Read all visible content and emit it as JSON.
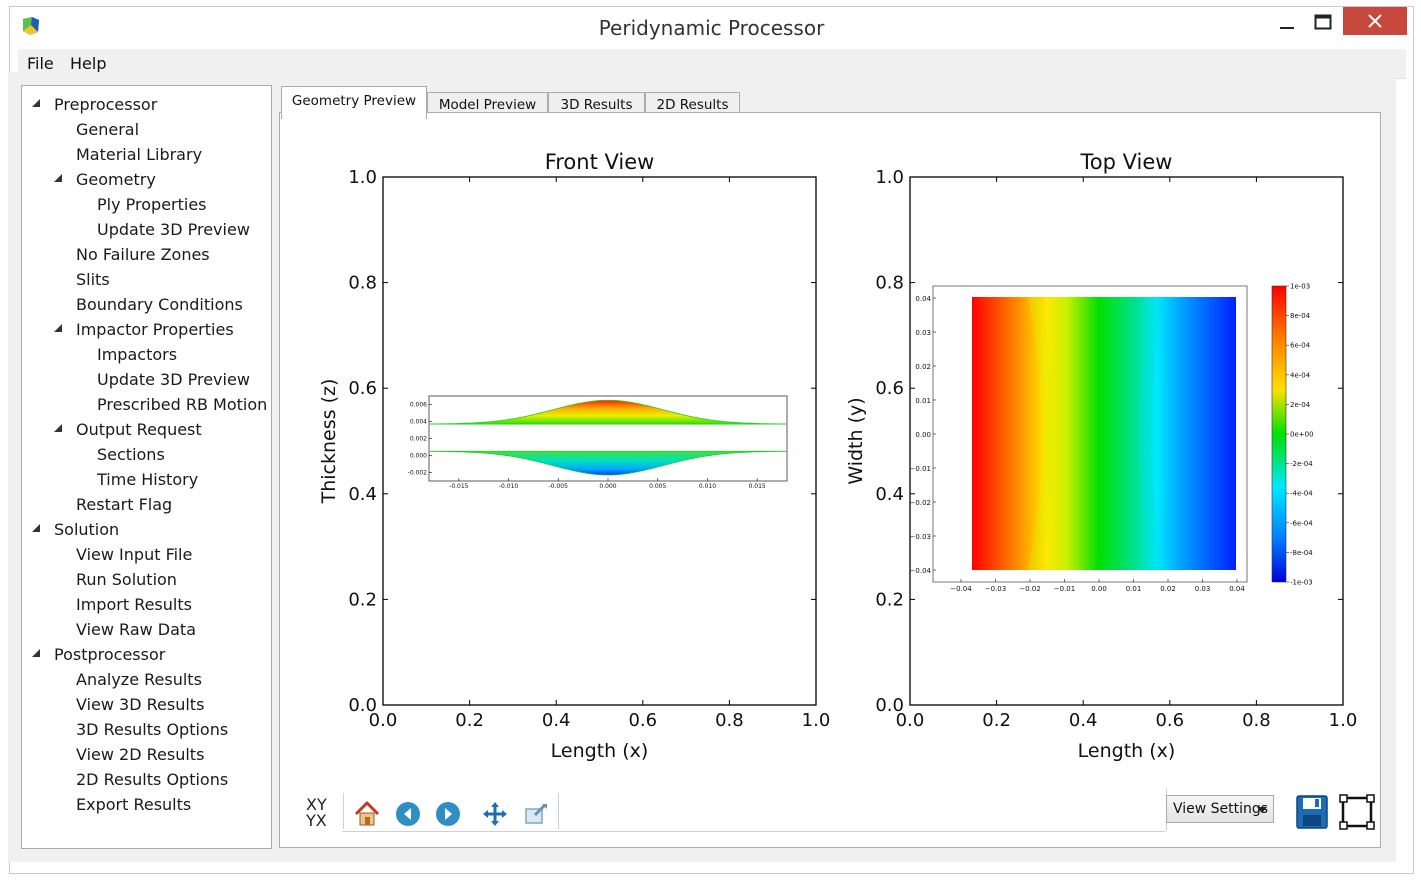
{
  "window": {
    "title": "Peridynamic Processor"
  },
  "menu": [
    {
      "label": "File"
    },
    {
      "label": "Help"
    }
  ],
  "tree": [
    {
      "label": "Preprocessor",
      "level": 0,
      "expanded": true
    },
    {
      "label": "General",
      "level": 1
    },
    {
      "label": "Material Library",
      "level": 1
    },
    {
      "label": "Geometry",
      "level": 1,
      "expanded": true
    },
    {
      "label": "Ply Properties",
      "level": 2
    },
    {
      "label": "Update 3D Preview",
      "level": 2
    },
    {
      "label": "No Failure Zones",
      "level": 1
    },
    {
      "label": "Slits",
      "level": 1
    },
    {
      "label": "Boundary Conditions",
      "level": 1
    },
    {
      "label": "Impactor Properties",
      "level": 1,
      "expanded": true
    },
    {
      "label": "Impactors",
      "level": 2
    },
    {
      "label": "Update 3D Preview",
      "level": 2
    },
    {
      "label": "Prescribed RB Motion",
      "level": 2
    },
    {
      "label": "Output Request",
      "level": 1,
      "expanded": true
    },
    {
      "label": "Sections",
      "level": 2
    },
    {
      "label": "Time History",
      "level": 2
    },
    {
      "label": "Restart Flag",
      "level": 1
    },
    {
      "label": "Solution",
      "level": 0,
      "expanded": true
    },
    {
      "label": "View Input File",
      "level": 1
    },
    {
      "label": "Run Solution",
      "level": 1
    },
    {
      "label": "Import Results",
      "level": 1
    },
    {
      "label": "View Raw Data",
      "level": 1
    },
    {
      "label": "Postprocessor",
      "level": 0,
      "expanded": true
    },
    {
      "label": "Analyze Results",
      "level": 1
    },
    {
      "label": "View 3D Results",
      "level": 1
    },
    {
      "label": "3D Results Options",
      "level": 1
    },
    {
      "label": "View 2D Results",
      "level": 1
    },
    {
      "label": "2D Results Options",
      "level": 1
    },
    {
      "label": "Export Results",
      "level": 1
    }
  ],
  "tabs": [
    {
      "label": "Geometry Preview",
      "active": true
    },
    {
      "label": "Model Preview",
      "active": false
    },
    {
      "label": "3D Results",
      "active": false
    },
    {
      "label": "2D Results",
      "active": false
    }
  ],
  "toolbar": {
    "xy_line1": "XY",
    "xy_line2": "YX",
    "view_settings_label": "View Settings",
    "icons": [
      "home-icon",
      "back-arrow-icon",
      "forward-arrow-icon",
      "pan-icon",
      "zoom-icon",
      "save-icon",
      "fullscreen-icon"
    ]
  },
  "chart_data": [
    {
      "type": "line",
      "title": "Front View",
      "xlabel": "Length (x)",
      "ylabel": "Thickness (z)",
      "xlim": [
        0.0,
        1.0
      ],
      "ylim": [
        0.0,
        1.0
      ],
      "xticks": [
        "0.0",
        "0.2",
        "0.4",
        "0.6",
        "0.8",
        "1.0"
      ],
      "yticks": [
        "0.0",
        "0.2",
        "0.4",
        "0.6",
        "0.8",
        "1.0"
      ],
      "inset": {
        "type": "area",
        "xlim": [
          -0.018,
          0.018
        ],
        "ylim": [
          -0.003,
          0.007
        ],
        "xticks": [
          "-0.015",
          "-0.010",
          "-0.005",
          "0.000",
          "0.005",
          "0.010",
          "0.015"
        ],
        "yticks": [
          "-0.002",
          "0.000",
          "0.002",
          "0.004",
          "0.006"
        ],
        "upper_baseline": 0.0037,
        "upper_peak": 0.0065,
        "lower_baseline": 0.0005,
        "lower_trough": -0.0023
      }
    },
    {
      "type": "heatmap",
      "title": "Top View",
      "xlabel": "Length (x)",
      "ylabel": "Width (y)",
      "xlim": [
        0.0,
        1.0
      ],
      "ylim": [
        0.0,
        1.0
      ],
      "xticks": [
        "0.0",
        "0.2",
        "0.4",
        "0.6",
        "0.8",
        "1.0"
      ],
      "yticks": [
        "0.0",
        "0.2",
        "0.4",
        "0.6",
        "0.8",
        "1.0"
      ],
      "inset": {
        "xlim": [
          -0.04,
          0.04
        ],
        "ylim": [
          -0.04,
          0.04
        ],
        "xticks": [
          "−0.04",
          "−0.03",
          "−0.02",
          "−0.01",
          "0.00",
          "0.01",
          "0.02",
          "0.03",
          "0.04"
        ],
        "yticks": [
          "0.04",
          "0.03",
          "0.02",
          "0.01",
          "0.00",
          "−0.01",
          "−0.02",
          "−0.03",
          "−0.04"
        ],
        "colorbar_ticks": [
          "1e-03",
          "8e-04",
          "6e-04",
          "4e-04",
          "2e-04",
          "0e+00",
          "-2e-04",
          "-4e-04",
          "-6e-04",
          "-8e-04",
          "-1e-03"
        ],
        "colorbar_range": [
          -0.001,
          0.001
        ]
      }
    }
  ]
}
